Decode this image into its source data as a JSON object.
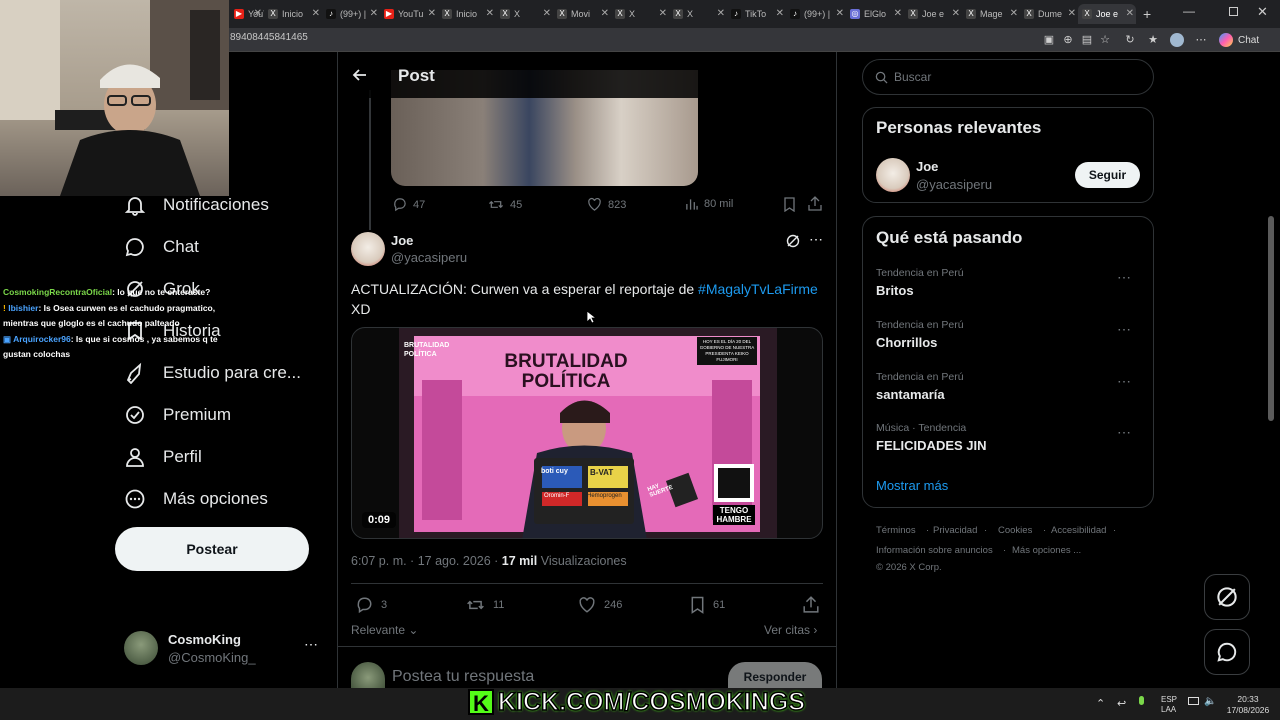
{
  "browser": {
    "tabs": [
      {
        "label": "YouTu",
        "icon": "youtube-icon"
      },
      {
        "label": "Inicio",
        "icon": "x-logo-icon"
      },
      {
        "label": "(99+) |",
        "icon": "tiktok-icon"
      },
      {
        "label": "YouTu",
        "icon": "youtube-icon"
      },
      {
        "label": "Inicio",
        "icon": "x-logo-icon"
      },
      {
        "label": "X",
        "icon": "x-logo-icon"
      },
      {
        "label": "Movi",
        "icon": "x-logo-icon"
      },
      {
        "label": "X",
        "icon": "x-logo-icon"
      },
      {
        "label": "X",
        "icon": "x-logo-icon"
      },
      {
        "label": "TikTo",
        "icon": "tiktok-icon"
      },
      {
        "label": "(99+) |",
        "icon": "tiktok-icon"
      },
      {
        "label": "ElGlo",
        "icon": "globe-icon"
      },
      {
        "label": "Joe e",
        "icon": "x-logo-icon"
      },
      {
        "label": "Mage",
        "icon": "x-logo-icon"
      },
      {
        "label": "Dume",
        "icon": "x-logo-icon"
      },
      {
        "label": "Joe e",
        "icon": "x-logo-icon"
      }
    ],
    "url": "89408445841465",
    "chat_label": "Chat"
  },
  "nav": {
    "items": [
      {
        "label": "Notificaciones",
        "icon": "bell-icon"
      },
      {
        "label": "Chat",
        "icon": "chat-bubble-icon"
      },
      {
        "label": "Grok",
        "icon": "grok-icon"
      },
      {
        "label": "Historia",
        "icon": "bookmark-icon"
      },
      {
        "label": "Estudio para cre...",
        "icon": "rocket-icon"
      },
      {
        "label": "Premium",
        "icon": "verified-icon"
      },
      {
        "label": "Perfil",
        "icon": "person-icon"
      },
      {
        "label": "Más opciones",
        "icon": "more-circle-icon"
      }
    ],
    "post_button": "Postear",
    "account": {
      "name": "CosmoKing",
      "handle": "@CosmoKing_"
    }
  },
  "stream_chat": [
    {
      "user": "CosmokingRecontraOficial",
      "text": ": lo que no te enteraste?"
    },
    {
      "user": "Ibishier",
      "text": ": Is Osea curwen es el cachudo pragmatico, mientras que gloglo es el cachudo palteado"
    },
    {
      "user": "Arquirocker96",
      "text": ": Is que si cosmos , ya sabemos q te gustan colochas"
    }
  ],
  "post": {
    "header_title": "Post",
    "quoted_stats": {
      "replies": "47",
      "reposts": "45",
      "likes": "823",
      "views": "80 mil"
    },
    "author": {
      "name": "Joe",
      "handle": "@yacasiperu"
    },
    "text": "ACTUALIZACIÓN: Curwen va a esperar el reportaje de ",
    "hashtag": "#MagalyTvLaFirme",
    "text_end": "XD",
    "video": {
      "duration": "0:09",
      "logo_text": "BRUTALIDAD POLÍTICA",
      "banner": "BRUTALIDAD POLÍTICA",
      "notice": "HOY ES EL DÍA 20 DEL GOBIERNO DE NUESTRA PRESIDENTA KEIKO FUJIMORI",
      "badge": "TENGO HAMBRE",
      "sign": "HAY SUERTE",
      "laptop_left": "boti cuy",
      "laptop_right": "B-VAT",
      "laptop_bottom_left": "Oromin-F",
      "laptop_bottom_right": "Hemoprogen"
    },
    "meta_time": "6:07 p. m. · 17 ago. 2026 · ",
    "meta_views": "17 mil",
    "meta_views_label": " Visualizaciones",
    "stats": {
      "replies": "3",
      "reposts": "11",
      "likes": "246",
      "bookmarks": "61"
    },
    "sort_label": "Relevante",
    "quotes_label": "Ver citas",
    "reply_placeholder": "Postea tu respuesta",
    "reply_button": "Responder"
  },
  "sidebar": {
    "search_placeholder": "Buscar",
    "relevant_title": "Personas relevantes",
    "relevant_person": {
      "name": "Joe",
      "handle": "@yacasiperu",
      "button": "Seguir"
    },
    "trends_title": "Qué está pasando",
    "trends": [
      {
        "category": "Tendencia en Perú",
        "name": "Britos"
      },
      {
        "category": "Tendencia en Perú",
        "name": "Chorrillos"
      },
      {
        "category": "Tendencia en Perú",
        "name": "santamaría"
      },
      {
        "category": "Música · Tendencia",
        "name": "FELICIDADES JIN"
      }
    ],
    "show_more": "Mostrar más",
    "footer": [
      "Términos",
      "Privacidad",
      "Cookies",
      "Accesibilidad",
      "Información sobre anuncios",
      "Más opciones ...",
      "© 2026 X Corp."
    ]
  },
  "taskbar": {
    "banner": "KICK.COM/COSMOKINGS",
    "lang_top": "ESP",
    "lang_bottom": "LAA",
    "time": "20:33",
    "date": "17/08/2026"
  }
}
